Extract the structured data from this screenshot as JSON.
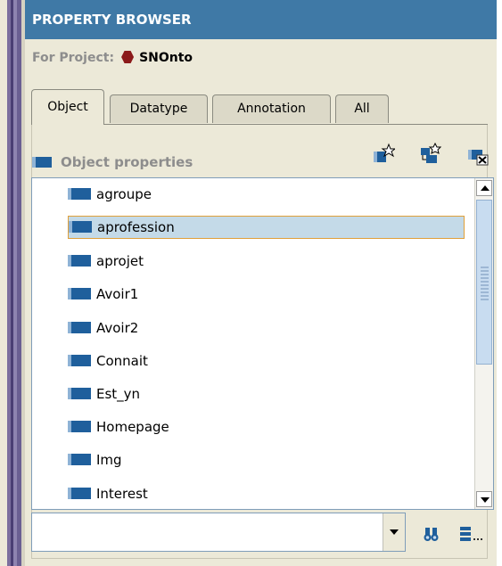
{
  "header": {
    "title": "PROPERTY BROWSER"
  },
  "project": {
    "label": "For Project:",
    "name": "SNOnto"
  },
  "tabs": [
    {
      "label": "Object",
      "active": true
    },
    {
      "label": "Datatype",
      "active": false
    },
    {
      "label": "Annotation",
      "active": false
    },
    {
      "label": "All",
      "active": false
    }
  ],
  "section": {
    "title": "Object properties"
  },
  "properties": [
    {
      "label": "agroupe",
      "selected": false
    },
    {
      "label": "aprofession",
      "selected": true
    },
    {
      "label": "aprojet",
      "selected": false
    },
    {
      "label": "Avoir1",
      "selected": false
    },
    {
      "label": "Avoir2",
      "selected": false
    },
    {
      "label": "Connait",
      "selected": false
    },
    {
      "label": "Est_yn",
      "selected": false
    },
    {
      "label": "Homepage",
      "selected": false
    },
    {
      "label": "Img",
      "selected": false
    },
    {
      "label": "Interest",
      "selected": false
    }
  ],
  "search": {
    "value": ""
  },
  "colors": {
    "header": "#3f79a6",
    "selection": "#c4dae8",
    "selection_border": "#e0a03a",
    "property_icon": "#1f5f9c"
  },
  "icons": [
    "project-hexagon-icon",
    "object-property-icon",
    "create-property-icon",
    "create-subproperty-icon",
    "delete-property-icon",
    "find-icon",
    "view-menu-icon"
  ]
}
